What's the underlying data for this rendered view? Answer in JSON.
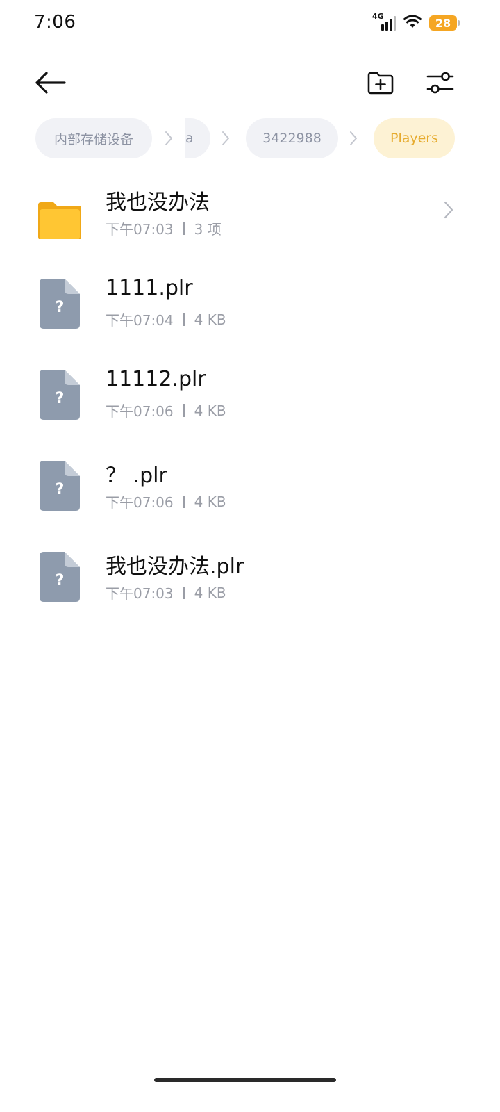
{
  "status_bar": {
    "time": "7:06",
    "network": "4G",
    "battery": "28",
    "battery_color": "#f5a623"
  },
  "toolbar": {
    "back_icon": "arrow-left-icon",
    "new_folder_icon": "folder-plus-icon",
    "filter_icon": "sliders-icon"
  },
  "breadcrumb": {
    "items": [
      {
        "label": "内部存储设备"
      },
      {
        "label": "a"
      },
      {
        "label": "3422988"
      },
      {
        "label": "Players"
      }
    ],
    "active_color": "#e6ab2e"
  },
  "files": [
    {
      "name": "我也没办法",
      "time": "下午07:03",
      "info": "3 项",
      "type": "folder",
      "icon": "folder-icon"
    },
    {
      "name": "1111.plr",
      "time": "下午07:04",
      "info": "4 KB",
      "type": "file",
      "icon": "unknown-file-icon"
    },
    {
      "name": "11112.plr",
      "time": "下午07:06",
      "info": "4 KB",
      "type": "file",
      "icon": "unknown-file-icon"
    },
    {
      "name": "？ .plr",
      "time": "下午07:06",
      "info": "4 KB",
      "type": "file",
      "icon": "unknown-file-icon"
    },
    {
      "name": "我也没办法.plr",
      "time": "下午07:03",
      "info": "4 KB",
      "type": "file",
      "icon": "unknown-file-icon"
    }
  ]
}
